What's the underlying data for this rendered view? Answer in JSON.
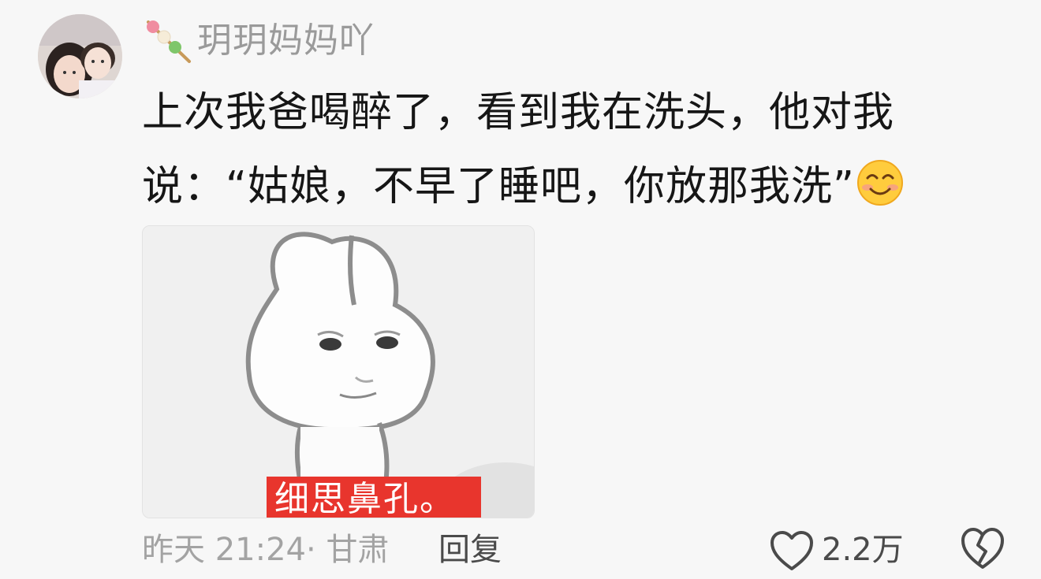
{
  "user": {
    "name": "玥玥妈妈吖"
  },
  "comment": {
    "line1": "上次我爸喝醉了，看到我在洗头，他对我",
    "line2": "说：“姑娘，不早了睡吧，你放那我洗”"
  },
  "image": {
    "caption": "细思鼻孔。"
  },
  "meta": {
    "time": "昨天 21:24",
    "separator": "·",
    "location": "甘肃"
  },
  "actions": {
    "reply_label": "回复",
    "like_count": "2.2万"
  },
  "icons": {
    "badge": "candy-skewer-icon",
    "emoji": "smiling-face-icon",
    "like": "heart-outline-icon",
    "dislike": "broken-heart-icon"
  },
  "colors": {
    "caption_bg": "#e8352d",
    "username": "#9a9a9a"
  }
}
